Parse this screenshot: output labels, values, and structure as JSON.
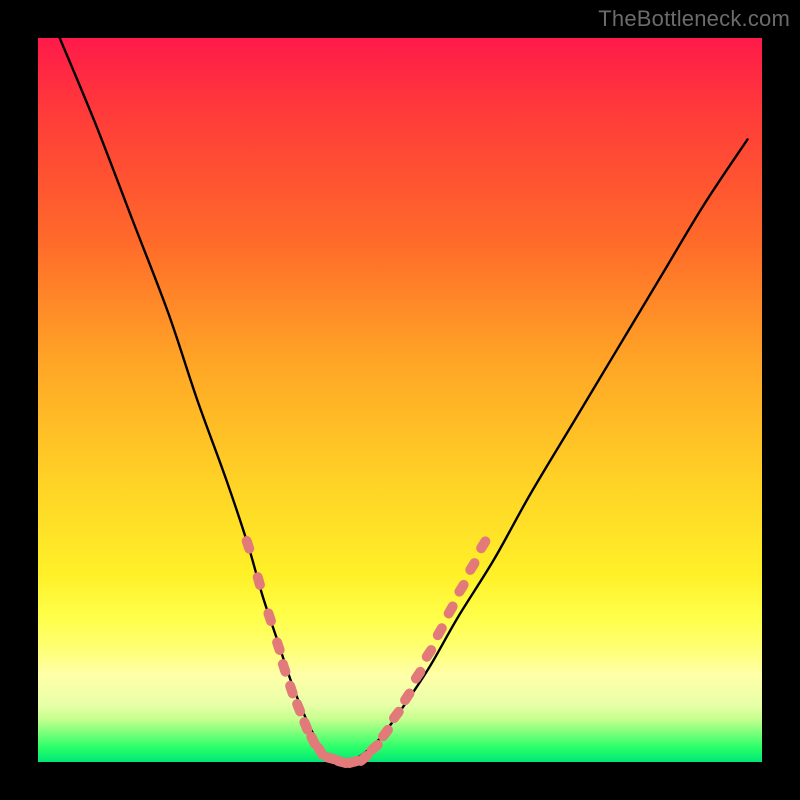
{
  "watermark": "TheBottleneck.com",
  "colors": {
    "frame": "#000000",
    "curve": "#000000",
    "markers": "#e27a7a",
    "gradient_top": "#ff1a4a",
    "gradient_bottom": "#00e676"
  },
  "chart_data": {
    "type": "line",
    "title": "",
    "xlabel": "",
    "ylabel": "",
    "xlim": [
      0,
      100
    ],
    "ylim": [
      0,
      100
    ],
    "grid": false,
    "legend": false,
    "series": [
      {
        "name": "bottleneck-curve",
        "x": [
          3,
          8,
          13,
          18,
          22,
          26,
          29,
          31,
          33,
          35,
          37,
          38.5,
          40,
          42,
          44,
          47,
          50,
          54,
          58,
          63,
          68,
          74,
          80,
          86,
          92,
          98
        ],
        "y": [
          100,
          88,
          75,
          62,
          50,
          39,
          30,
          23,
          17,
          11,
          6,
          3,
          0.5,
          0,
          0.5,
          3,
          7,
          13,
          20,
          28,
          37,
          47,
          57,
          67,
          77,
          86
        ]
      }
    ],
    "markers": {
      "name": "highlight-points",
      "shape": "capsule",
      "color": "#e27a7a",
      "points": [
        {
          "x": 29.0,
          "y": 30
        },
        {
          "x": 30.5,
          "y": 25
        },
        {
          "x": 32.0,
          "y": 20
        },
        {
          "x": 33.2,
          "y": 16
        },
        {
          "x": 34.0,
          "y": 13
        },
        {
          "x": 35.0,
          "y": 10
        },
        {
          "x": 36.0,
          "y": 7.5
        },
        {
          "x": 37.0,
          "y": 5
        },
        {
          "x": 38.0,
          "y": 3
        },
        {
          "x": 39.0,
          "y": 1.5
        },
        {
          "x": 40.5,
          "y": 0.5
        },
        {
          "x": 42.0,
          "y": 0
        },
        {
          "x": 43.5,
          "y": 0
        },
        {
          "x": 45.0,
          "y": 0.5
        },
        {
          "x": 46.5,
          "y": 2
        },
        {
          "x": 48.0,
          "y": 4
        },
        {
          "x": 49.5,
          "y": 6.5
        },
        {
          "x": 51.0,
          "y": 9
        },
        {
          "x": 52.5,
          "y": 12
        },
        {
          "x": 54.0,
          "y": 15
        },
        {
          "x": 55.5,
          "y": 18
        },
        {
          "x": 57.0,
          "y": 21
        },
        {
          "x": 58.5,
          "y": 24
        },
        {
          "x": 60.0,
          "y": 27
        },
        {
          "x": 61.5,
          "y": 30
        }
      ]
    }
  }
}
